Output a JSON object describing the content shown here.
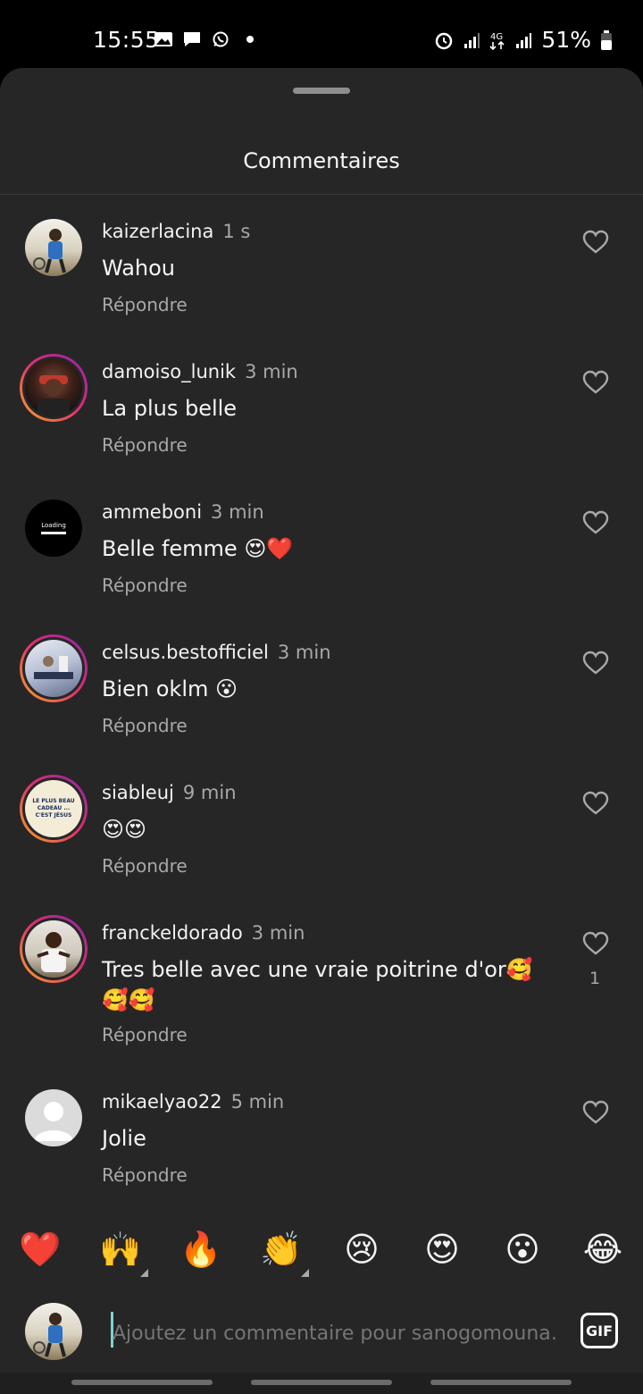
{
  "status_bar": {
    "time": "15:55",
    "battery": "51%",
    "left_icons": [
      "gallery-icon",
      "message-icon",
      "whatsapp-icon"
    ],
    "right_icons": [
      "alarm-icon",
      "signal-icon",
      "4g-icon",
      "signal-icon",
      "battery-icon"
    ]
  },
  "sheet": {
    "title": "Commentaires"
  },
  "comments": [
    {
      "username": "kaizerlacina",
      "time": "1 s",
      "text": "Wahou",
      "reply": "Répondre",
      "likes": ""
    },
    {
      "username": "damoiso_lunik",
      "time": "3 min",
      "text": "La plus belle",
      "reply": "Répondre",
      "likes": ""
    },
    {
      "username": "ammeboni",
      "time": "3 min",
      "text": "Belle femme 😍❤️",
      "reply": "Répondre",
      "likes": "",
      "avatar_text": "Loading"
    },
    {
      "username": "celsus.bestofficiel",
      "time": "3 min",
      "text": "Bien oklm 😮",
      "reply": "Répondre",
      "likes": ""
    },
    {
      "username": "siableuj",
      "time": "9 min",
      "text": "😍😍",
      "reply": "Répondre",
      "likes": "",
      "avatar_text": "LE PLUS BEAU CADEAU ... C'EST JÉSUS"
    },
    {
      "username": "franckeldorado",
      "time": "3 min",
      "text": "Tres belle avec une vraie poitrine d'or🥰🥰🥰",
      "reply": "Répondre",
      "likes": "1"
    },
    {
      "username": "mikaelyao22",
      "time": "5 min",
      "text": "Jolie",
      "reply": "Répondre",
      "likes": ""
    }
  ],
  "quick_reactions": [
    "❤️",
    "🙌",
    "🔥",
    "👏",
    "😢",
    "😍",
    "😮",
    "😂"
  ],
  "composer": {
    "placeholder": "Ajoutez un commentaire pour sanogomouna…",
    "gif_label": "GIF"
  },
  "colors": {
    "sheet_bg": "#262626",
    "secondary_text": "#a8a8a8",
    "story_ring": "#e1306c",
    "caret": "#7fd3d0"
  }
}
